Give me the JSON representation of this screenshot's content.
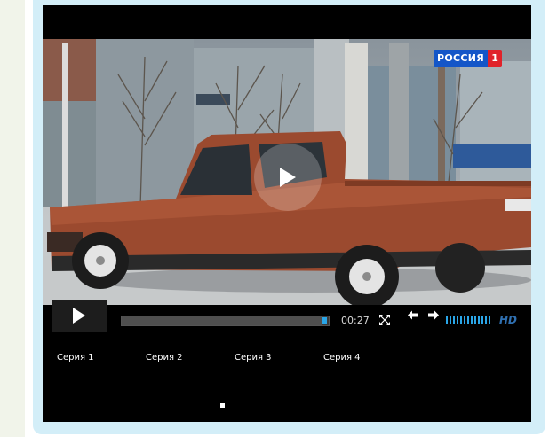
{
  "video": {
    "channel_logo_text": "РОССИЯ",
    "channel_logo_number": "1"
  },
  "controls": {
    "time": "00:27",
    "hd_label": "HD",
    "progress_fraction": 0.99,
    "volume_fraction": 0.6
  },
  "episodes": [
    {
      "label": "Серия 1"
    },
    {
      "label": "Серия 2"
    },
    {
      "label": "Серия 3"
    },
    {
      "label": "Серия 4"
    }
  ],
  "colors": {
    "accent": "#2aa6e8",
    "frame": "#d3eef8",
    "player_bg": "#000000"
  },
  "icons": [
    "play-icon",
    "fullscreen-icon",
    "arrow-left-icon",
    "arrow-right-icon",
    "volume-icon"
  ]
}
